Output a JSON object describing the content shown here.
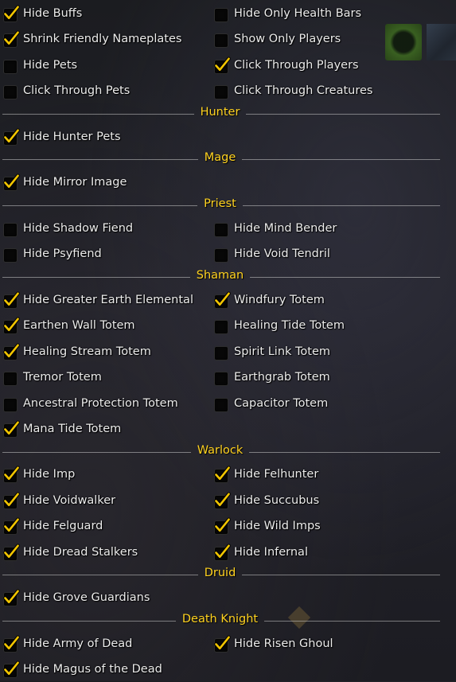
{
  "general": [
    [
      {
        "label": "Hide Buffs",
        "checked": true
      },
      {
        "label": "Hide Only Health Bars",
        "checked": false
      }
    ],
    [
      {
        "label": "Shrink Friendly Nameplates",
        "checked": true
      },
      {
        "label": "Show Only Players",
        "checked": false
      }
    ],
    [
      {
        "label": "Hide Pets",
        "checked": false
      },
      {
        "label": "Click Through Players",
        "checked": true
      }
    ],
    [
      {
        "label": "Click Through Pets",
        "checked": false
      },
      {
        "label": "Click Through Creatures",
        "checked": false
      }
    ]
  ],
  "sections": {
    "hunter": {
      "title": "Hunter",
      "rows": [
        [
          {
            "label": "Hide Hunter Pets",
            "checked": true
          }
        ]
      ]
    },
    "mage": {
      "title": "Mage",
      "rows": [
        [
          {
            "label": "Hide Mirror Image",
            "checked": true
          }
        ]
      ]
    },
    "priest": {
      "title": "Priest",
      "rows": [
        [
          {
            "label": "Hide Shadow Fiend",
            "checked": false
          },
          {
            "label": "Hide Mind Bender",
            "checked": false
          }
        ],
        [
          {
            "label": "Hide Psyfiend",
            "checked": false
          },
          {
            "label": "Hide Void Tendril",
            "checked": false
          }
        ]
      ]
    },
    "shaman": {
      "title": "Shaman",
      "rows": [
        [
          {
            "label": "Hide Greater Earth Elemental",
            "checked": true
          },
          {
            "label": "Windfury Totem",
            "checked": true
          }
        ],
        [
          {
            "label": "Earthen Wall Totem",
            "checked": true
          },
          {
            "label": "Healing Tide Totem",
            "checked": false
          }
        ],
        [
          {
            "label": "Healing Stream Totem",
            "checked": true
          },
          {
            "label": "Spirit Link Totem",
            "checked": false
          }
        ],
        [
          {
            "label": "Tremor Totem",
            "checked": false
          },
          {
            "label": "Earthgrab Totem",
            "checked": false
          }
        ],
        [
          {
            "label": "Ancestral Protection Totem",
            "checked": false
          },
          {
            "label": "Capacitor Totem",
            "checked": false
          }
        ],
        [
          {
            "label": "Mana Tide Totem",
            "checked": true
          }
        ]
      ]
    },
    "warlock": {
      "title": "Warlock",
      "rows": [
        [
          {
            "label": "Hide Imp",
            "checked": true
          },
          {
            "label": "Hide Felhunter",
            "checked": true
          }
        ],
        [
          {
            "label": "Hide Voidwalker",
            "checked": true
          },
          {
            "label": "Hide Succubus",
            "checked": true
          }
        ],
        [
          {
            "label": "Hide Felguard",
            "checked": true
          },
          {
            "label": "Hide Wild Imps",
            "checked": true
          }
        ],
        [
          {
            "label": "Hide Dread Stalkers",
            "checked": true
          },
          {
            "label": "Hide Infernal",
            "checked": true
          }
        ]
      ]
    },
    "druid": {
      "title": "Druid",
      "rows": [
        [
          {
            "label": "Hide Grove Guardians",
            "checked": true
          }
        ]
      ]
    },
    "death_knight": {
      "title": "Death Knight",
      "rows": [
        [
          {
            "label": "Hide Army of Dead",
            "checked": true
          },
          {
            "label": "Hide Risen Ghoul",
            "checked": true
          }
        ],
        [
          {
            "label": "Hide Magus of the Dead",
            "checked": true
          }
        ]
      ]
    }
  },
  "colors": {
    "header": "#ffd21f",
    "label": "#ececec",
    "check": "#f2c500"
  }
}
